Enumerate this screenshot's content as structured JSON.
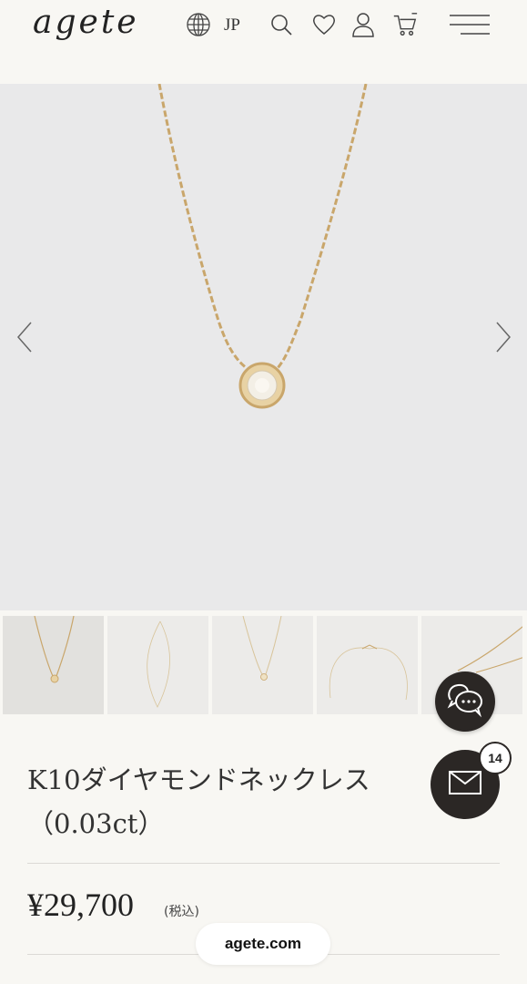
{
  "header": {
    "logo": "agete",
    "language": "JP",
    "icons": [
      "globe-icon",
      "search-icon",
      "heart-icon",
      "user-icon",
      "cart-icon",
      "menu-icon"
    ]
  },
  "gallery": {
    "prev_icon": "chevron-left-icon",
    "next_icon": "chevron-right-icon",
    "thumbnail_count": 5
  },
  "product": {
    "title_line1": "K10ダイヤモンドネックレス",
    "title_line2": "（0.03ct）",
    "price": "¥29,700",
    "tax_note": "(税込)"
  },
  "floating": {
    "chat_icon": "chat-icon",
    "mail_icon": "mail-icon",
    "mail_badge": "14"
  },
  "footer": {
    "site_label": "agete.com"
  },
  "colors": {
    "background": "#f8f7f3",
    "hero_bg": "#e9e9ea",
    "gold": "#c9a66b",
    "dark": "#2b2725"
  }
}
